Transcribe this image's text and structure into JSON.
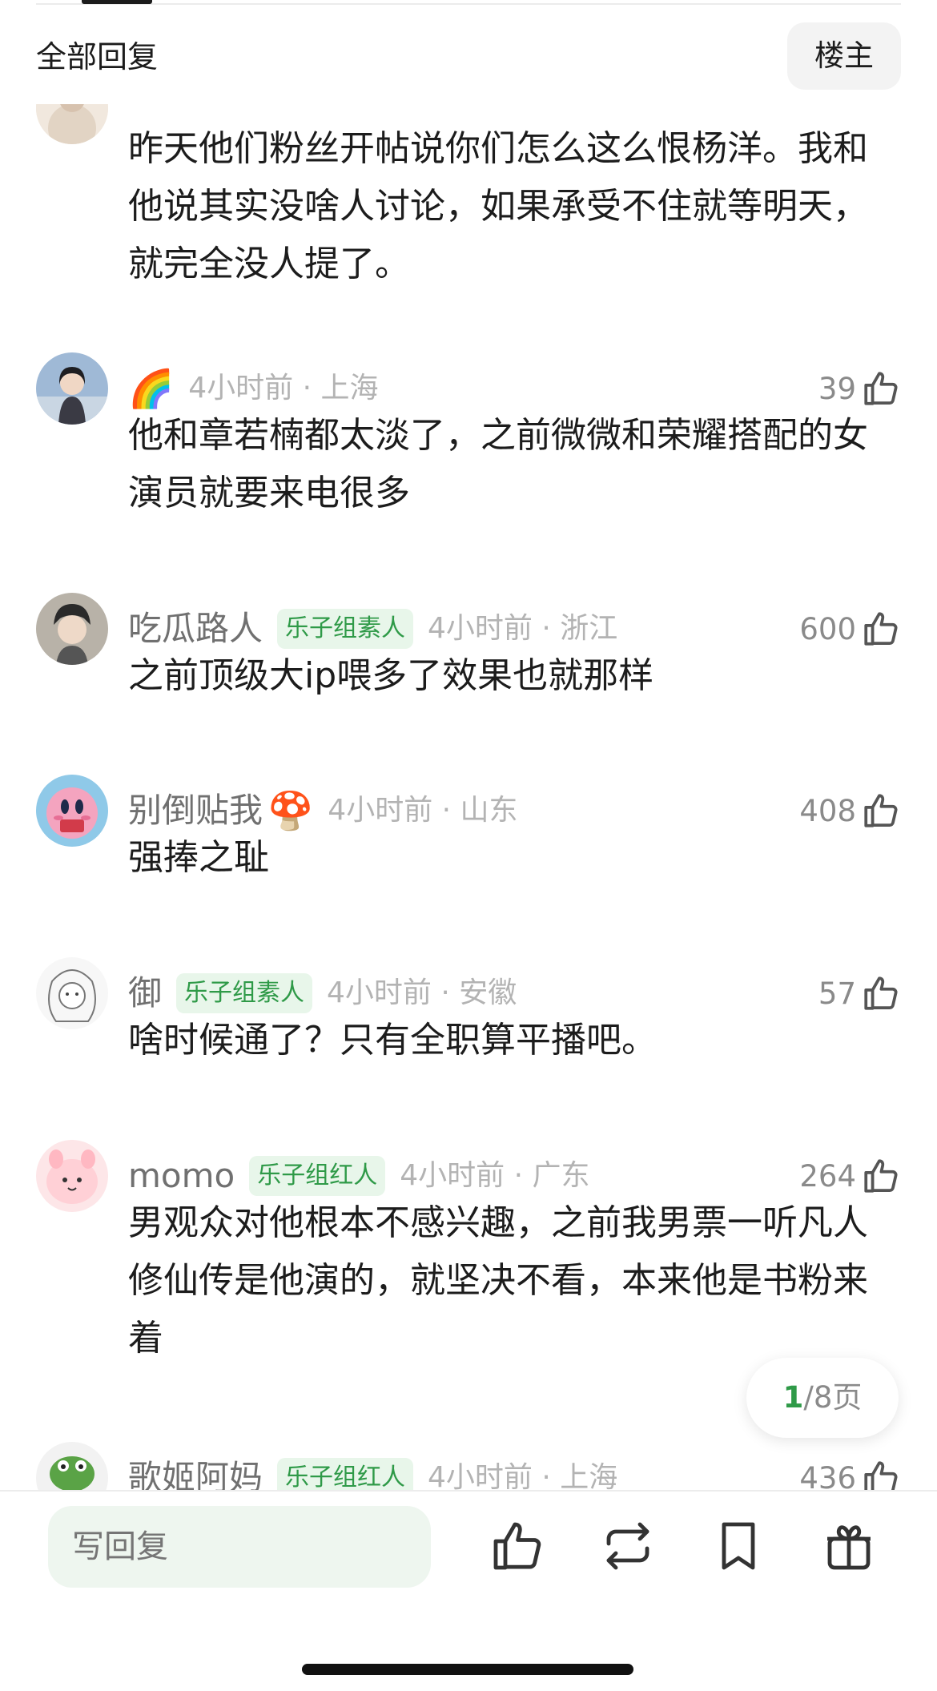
{
  "header": {
    "title": "全部回复",
    "owner_button": "楼主"
  },
  "comments": [
    {
      "username": "",
      "text": "昨天他们粉丝开帖说你们怎么这么恨杨洋。我和他说其实没啥人讨论，如果承受不住就等明天，就完全没人提了。"
    },
    {
      "username": "🌈",
      "time": "4小时前",
      "location": "上海",
      "time_loc": "4小时前 · 上海",
      "likes": "39",
      "text": "他和章若楠都太淡了，之前微微和荣耀搭配的女演员就要来电很多"
    },
    {
      "username": "吃瓜路人",
      "badge": "乐子组素人",
      "time_loc": "4小时前 · 浙江",
      "likes": "600",
      "text": "之前顶级大ip喂多了效果也就那样"
    },
    {
      "username": "别倒贴我",
      "emoji": "🍄",
      "time_loc": "4小时前 · 山东",
      "likes": "408",
      "text": "强捧之耻"
    },
    {
      "username": "御",
      "badge": "乐子组素人",
      "time_loc": "4小时前 · 安徽",
      "likes": "57",
      "text": "啥时候通了？只有全职算平播吧。"
    },
    {
      "username": "momo",
      "badge": "乐子组红人",
      "time_loc": "4小时前 · 广东",
      "likes": "264",
      "text": "男观众对他根本不感兴趣，之前我男票一听凡人修仙传是他演的，就坚决不看，本来他是书粉来着"
    },
    {
      "username": "歌姬阿妈",
      "badge": "乐子组红人",
      "time_loc": "4小时前 · 上海",
      "likes": "436"
    }
  ],
  "pagination": {
    "current": "1",
    "total": "/8页"
  },
  "bottom_bar": {
    "reply_placeholder": "写回复",
    "icons": [
      "like-icon",
      "repost-icon",
      "bookmark-icon",
      "gift-icon"
    ]
  },
  "colors": {
    "badge_text": "#2f9a48",
    "badge_bg": "#e8f6ea",
    "muted_text": "#b3b3b3",
    "username_text": "#707070"
  }
}
